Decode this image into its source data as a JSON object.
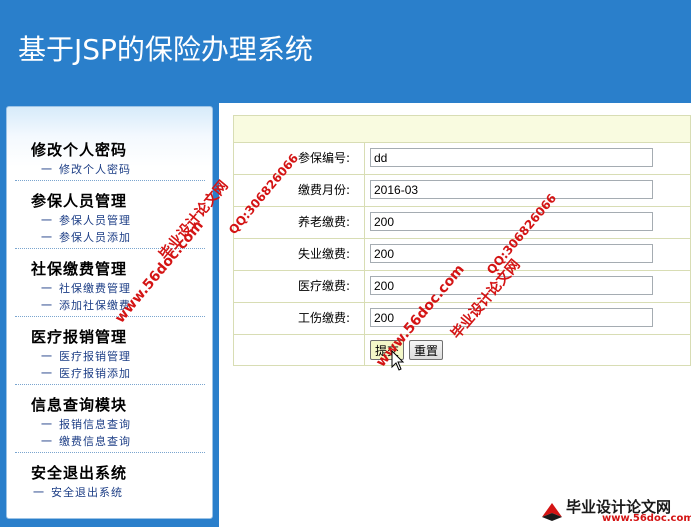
{
  "header": {
    "title": "基于JSP的保险办理系统"
  },
  "sidebar": {
    "groups": [
      {
        "title": "修改个人密码",
        "items": [
          "修改个人密码"
        ]
      },
      {
        "title": "参保人员管理",
        "items": [
          "参保人员管理",
          "参保人员添加"
        ]
      },
      {
        "title": "社保缴费管理",
        "items": [
          "社保缴费管理",
          "添加社保缴费"
        ]
      },
      {
        "title": "医疗报销管理",
        "items": [
          "医疗报销管理",
          "医疗报销添加"
        ]
      },
      {
        "title": "信息查询模块",
        "items": [
          "报销信息查询",
          "缴费信息查询"
        ]
      },
      {
        "title": "安全退出系统",
        "items": [
          "安全退出系统"
        ]
      }
    ],
    "dash": "一"
  },
  "form": {
    "fields": [
      {
        "label": "参保编号:",
        "value": "dd"
      },
      {
        "label": "缴费月份:",
        "value": "2016-03"
      },
      {
        "label": "养老缴费:",
        "value": "200"
      },
      {
        "label": "失业缴费:",
        "value": "200"
      },
      {
        "label": "医疗缴费:",
        "value": "200"
      },
      {
        "label": "工伤缴费:",
        "value": "200"
      }
    ],
    "submit_label": "提交",
    "reset_label": "重置"
  },
  "watermark": {
    "brand": "毕业设计论文网",
    "url": "www.56doc.com",
    "qq": "QQ:306826066"
  },
  "footer": {
    "brand": "毕业设计论文网",
    "url": "www.56doc.com"
  }
}
